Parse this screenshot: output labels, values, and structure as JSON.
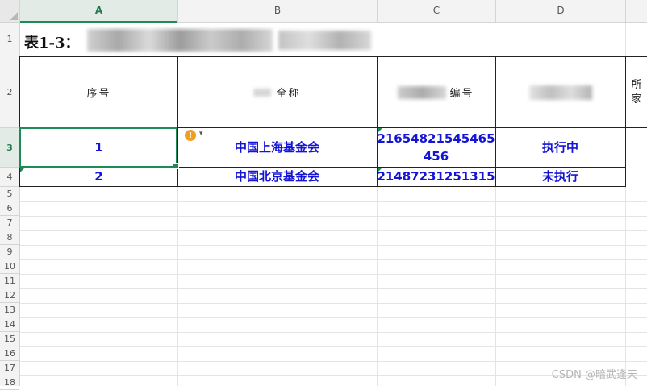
{
  "columns": [
    "A",
    "B",
    "C",
    "D"
  ],
  "rows": [
    "1",
    "2",
    "3",
    "4",
    "5",
    "6",
    "7",
    "8",
    "9",
    "10",
    "11",
    "12",
    "13",
    "14",
    "15",
    "16",
    "17",
    "18"
  ],
  "title": "表1-3：",
  "header": {
    "seq": "序号",
    "name": "全称",
    "code": "编号",
    "extra": "所\n家"
  },
  "data_rows": [
    {
      "seq": "1",
      "name": "中国上海基金会",
      "code": "21654821545465\n456",
      "status": "执行中"
    },
    {
      "seq": "2",
      "name": "中国北京基金会",
      "code": "21487231251315",
      "status": "未执行"
    }
  ],
  "warning_icon": "!",
  "warning_caret": "▾",
  "watermark": "CSDN @暗武逢天",
  "colors": {
    "accent": "#1e8a56",
    "data_text": "#1414d6"
  }
}
